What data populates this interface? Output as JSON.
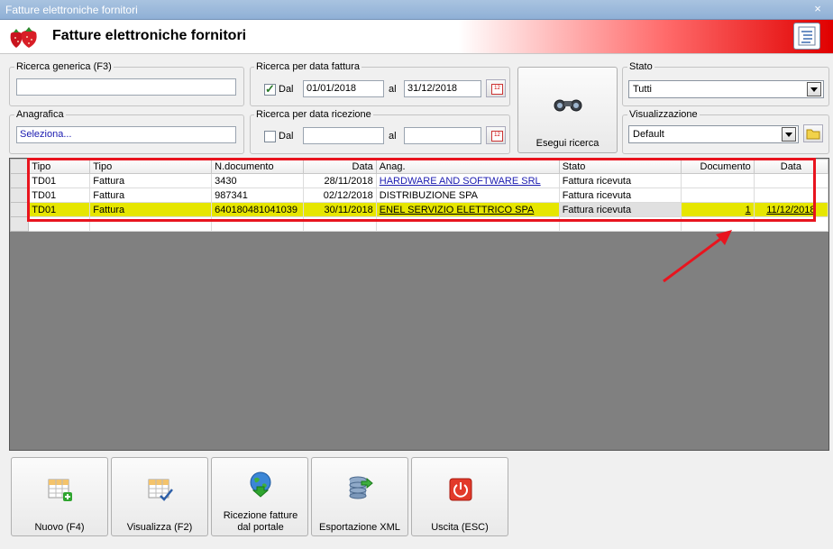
{
  "window": {
    "title": "Fatture elettroniche fornitori",
    "close_glyph": "×"
  },
  "header": {
    "title": "Fatture elettroniche fornitori",
    "logo_icon": "strawberries-icon",
    "report_icon": "report-list-icon"
  },
  "search": {
    "generic_label": "Ricerca generica (F3)",
    "generic_value": "",
    "anagrafica_label": "Anagrafica",
    "anagrafica_value": "Seleziona..."
  },
  "invoice_date": {
    "label": "Ricerca per data fattura",
    "checked": true,
    "dal_label": "Dal",
    "from": "01/01/2018",
    "al_label": "al",
    "to": "31/12/2018"
  },
  "receipt_date": {
    "label": "Ricerca per data ricezione",
    "checked": false,
    "dal_label": "Dal",
    "from": "",
    "al_label": "al",
    "to": ""
  },
  "run_search": {
    "label": "Esegui ricerca",
    "icon": "binoculars-icon"
  },
  "state": {
    "label": "Stato",
    "value": "Tutti"
  },
  "view": {
    "label": "Visualizzazione",
    "value": "Default",
    "folder_icon": "folder-icon"
  },
  "grid": {
    "columns": [
      "Tipo",
      "Tipo",
      "N.documento",
      "Data",
      "Anag.",
      "Stato",
      "Documento",
      "Data"
    ],
    "rows": [
      {
        "tipo": "TD01",
        "tipo2": "Fattura",
        "ndoc": "3430",
        "data": "28/11/2018",
        "anag": "HARDWARE AND SOFTWARE SRL",
        "stato": "Fattura ricevuta",
        "documento": "",
        "data2": ""
      },
      {
        "tipo": "TD01",
        "tipo2": "Fattura",
        "ndoc": "987341",
        "data": "02/12/2018",
        "anag": "DISTRIBUZIONE SPA",
        "stato": "Fattura ricevuta",
        "documento": "",
        "data2": ""
      },
      {
        "tipo": "TD01",
        "tipo2": "Fattura",
        "ndoc": "640180481041039",
        "data": "30/11/2018",
        "anag": "ENEL SERVIZIO ELETTRICO SPA",
        "stato": "Fattura ricevuta",
        "documento": "1",
        "data2": "11/12/2018"
      }
    ],
    "highlight_color": "#e6e600",
    "annotation_color": "#e8141e"
  },
  "footer_buttons": [
    {
      "label": "Nuovo (F4)",
      "icon": "new-grid-icon"
    },
    {
      "label": "Visualizza (F2)",
      "icon": "view-grid-icon"
    },
    {
      "label": "Ricezione fatture dal portale",
      "icon": "globe-download-icon"
    },
    {
      "label": "Esportazione XML",
      "icon": "database-export-icon"
    },
    {
      "label": "Uscita (ESC)",
      "icon": "power-icon"
    }
  ]
}
